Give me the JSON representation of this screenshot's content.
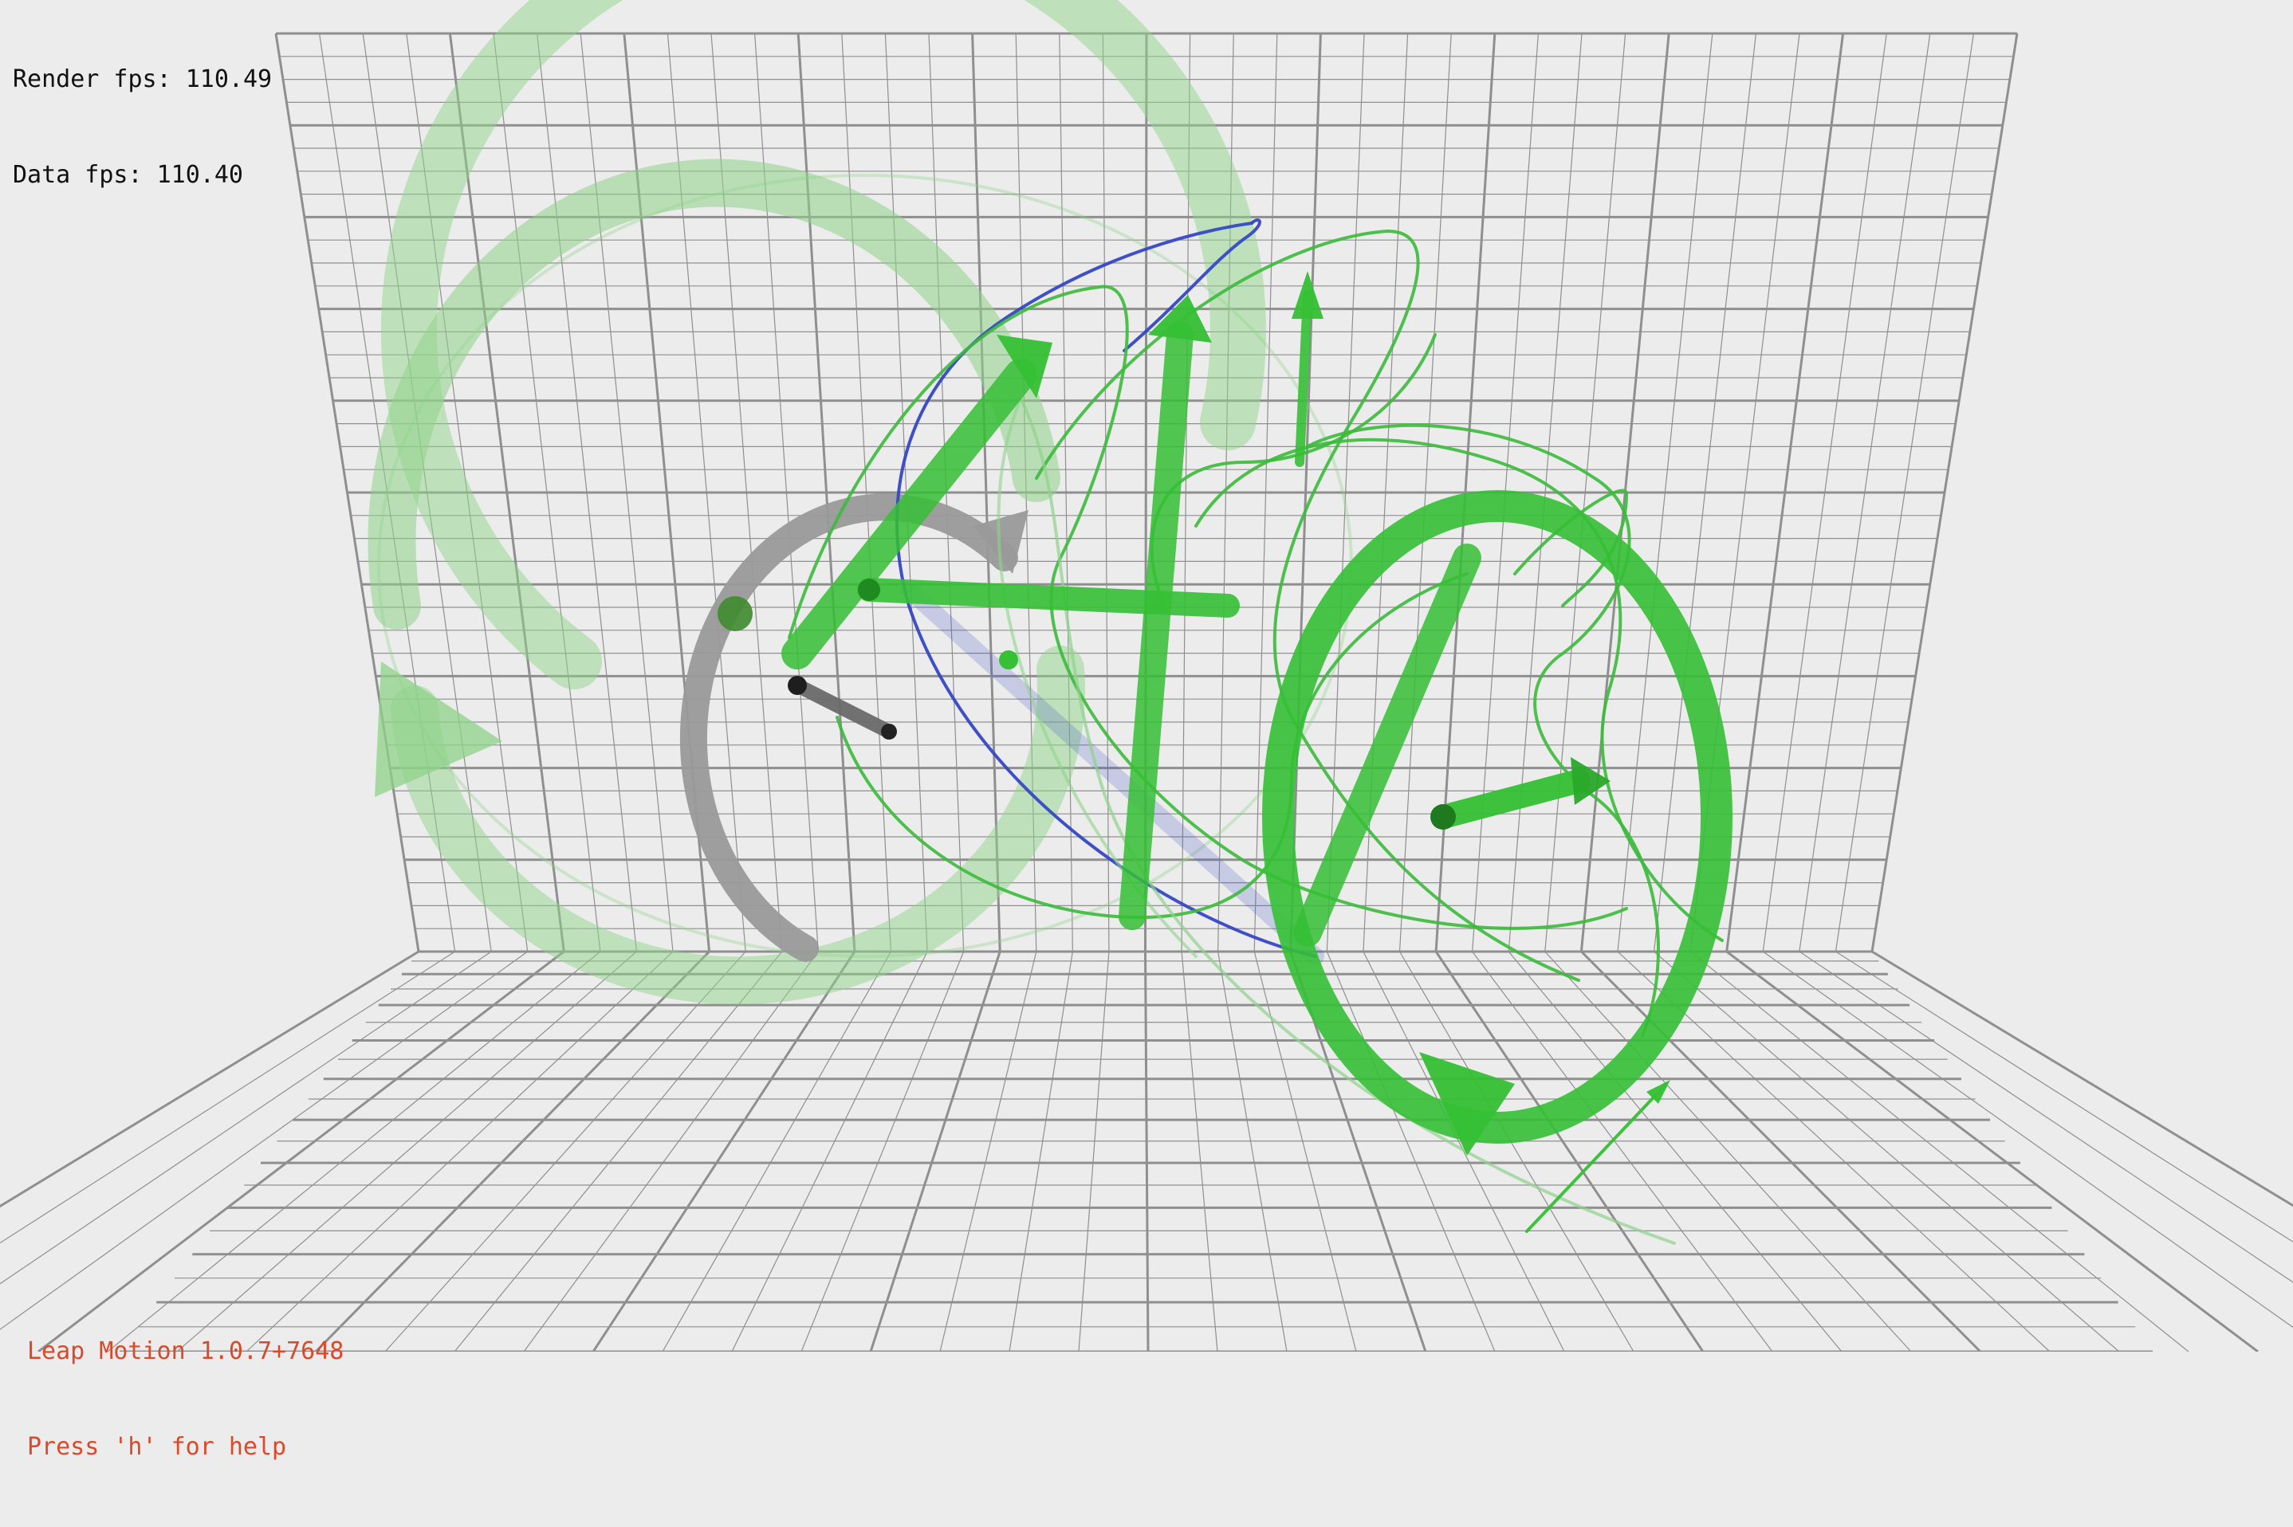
{
  "hud": {
    "render_fps_label": "Render fps: 110.49",
    "data_fps_label": "Data fps: 110.40"
  },
  "footer": {
    "version_label": "Leap Motion 1.0.7+7648",
    "help_hint": "Press 'h' for help"
  },
  "colors": {
    "background": "#ececec",
    "grid": "#8f8f8f",
    "gesture_green": "#35c035",
    "light_green": "#8fd38a",
    "trail_green": "#3cba3c",
    "gray": "#9a9a9a",
    "blue": "#3648c4",
    "info_text": "#d94a2a"
  }
}
